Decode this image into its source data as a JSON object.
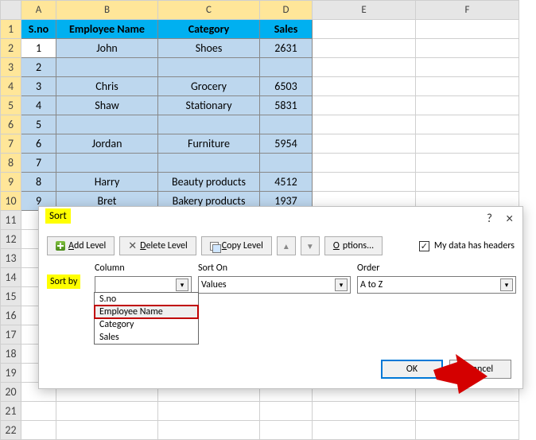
{
  "columns": [
    "A",
    "B",
    "C",
    "D",
    "E",
    "F"
  ],
  "rows": [
    "1",
    "2",
    "3",
    "4",
    "5",
    "6",
    "7",
    "8",
    "9",
    "10",
    "11",
    "12",
    "13",
    "14",
    "15",
    "16",
    "17",
    "18",
    "19",
    "20",
    "21",
    "22"
  ],
  "headers": {
    "sno": "S.no",
    "emp": "Employee Name",
    "cat": "Category",
    "sales": "Sales"
  },
  "data": [
    {
      "sno": "1",
      "emp": "John",
      "cat": "Shoes",
      "sales": "2631"
    },
    {
      "sno": "2",
      "emp": "",
      "cat": "",
      "sales": ""
    },
    {
      "sno": "3",
      "emp": "Chris",
      "cat": "Grocery",
      "sales": "6503"
    },
    {
      "sno": "4",
      "emp": "Shaw",
      "cat": "Stationary",
      "sales": "5831"
    },
    {
      "sno": "5",
      "emp": "",
      "cat": "",
      "sales": ""
    },
    {
      "sno": "6",
      "emp": "Jordan",
      "cat": "Furniture",
      "sales": "5954"
    },
    {
      "sno": "7",
      "emp": "",
      "cat": "",
      "sales": ""
    },
    {
      "sno": "8",
      "emp": "Harry",
      "cat": "Beauty products",
      "sales": "4512"
    },
    {
      "sno": "9",
      "emp": "Bret",
      "cat": "Bakery products",
      "sales": "1937"
    }
  ],
  "dialog": {
    "title": "Sort",
    "help": "?",
    "close": "×",
    "addLevel": "Add Level",
    "deleteLevel": "Delete Level",
    "copyLevel": "Copy Level",
    "options": "Options...",
    "myDataHasHeaders": "My data has headers",
    "check": "✓",
    "columnLabel": "Column",
    "sortOnLabel": "Sort On",
    "orderLabel": "Order",
    "sortBy": "Sort by",
    "sortByValue": "",
    "sortOnValue": "Values",
    "orderValue": "A to Z",
    "dropdownOptions": [
      "S.no",
      "Employee Name",
      "Category",
      "Sales"
    ],
    "ok": "OK",
    "cancel": "Cancel"
  }
}
